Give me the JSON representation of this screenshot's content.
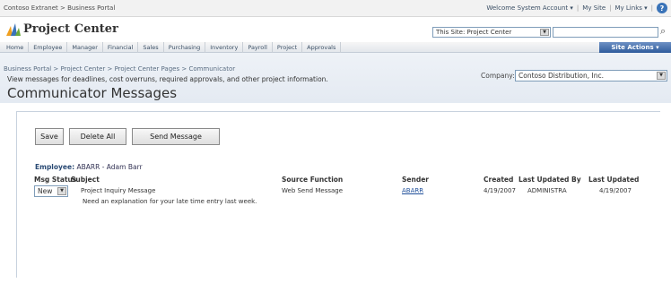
{
  "topbar": {
    "crumb": "Contoso Extranet > Business Portal",
    "welcome": "Welcome System Account ▾",
    "my_site": "My Site",
    "my_links": "My Links ▾",
    "help_icon": "help-icon"
  },
  "header": {
    "site_title": "Project Center",
    "scope_value": "This Site: Project Center",
    "search_value": "",
    "search_icon": "search-icon"
  },
  "nav": {
    "tabs": [
      "Home",
      "Employee",
      "Manager",
      "Financial",
      "Sales",
      "Purchasing",
      "Inventory",
      "Payroll",
      "Project",
      "Approvals"
    ],
    "site_actions": "Site Actions ▾"
  },
  "page": {
    "breadcrumb": "Business Portal > Project Center > Project Center Pages > Communicator",
    "subtitle": "View messages for deadlines, cost overruns, required approvals, and other project information.",
    "title": "Communicator Messages",
    "company_label": "Company:",
    "company_value": "Contoso Distribution, Inc."
  },
  "toolbar": {
    "save": "Save",
    "delete_all": "Delete All",
    "send_message": "Send Message"
  },
  "employee": {
    "label": "Employee:",
    "value": "ABARR - Adam Barr"
  },
  "table": {
    "headers": {
      "msg_status": "Msg Status",
      "subject": "Subject",
      "source_function": "Source Function",
      "sender": "Sender",
      "created": "Created",
      "last_updated_by": "Last Updated By",
      "last_updated": "Last Updated"
    },
    "rows": [
      {
        "status": "New",
        "subject": "Project Inquiry Message",
        "source_function": "Web Send Message",
        "sender": "ABARR",
        "created": "4/19/2007",
        "last_updated_by": "ADMINISTRA",
        "last_updated": "4/19/2007",
        "body": "Need an explanation for your late time entry last week."
      }
    ]
  },
  "colors": {
    "accent": "#2f5c9c",
    "link": "#1f4f9a"
  }
}
